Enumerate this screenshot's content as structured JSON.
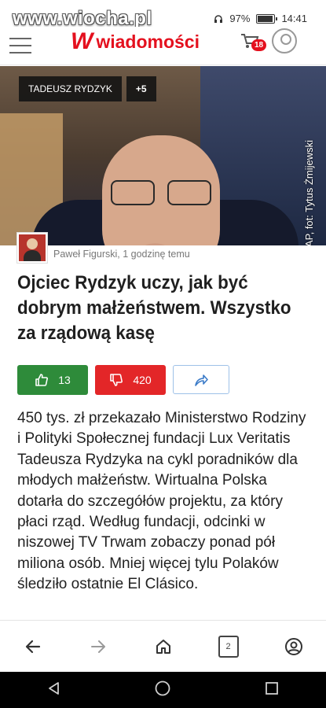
{
  "status": {
    "watermark": "www.wiocha.pl",
    "battery": "97%",
    "time": "14:41"
  },
  "header": {
    "logo_mark": "W",
    "logo_text": "wiadomości",
    "cart_count": "18"
  },
  "hero": {
    "tags": [
      "TADEUSZ RYDZYK",
      "+5"
    ],
    "credit": "Źródło: PAP, fot: Tytus Żmijewski"
  },
  "article": {
    "author_meta": "Paweł Figurski, 1 godzinę temu",
    "title": "Ojciec Rydzyk uczy, jak być dobrym małżeństwem. Wszystko za rządową kasę",
    "likes": "13",
    "dislikes": "420",
    "lead": "450 tys. zł przekazało Ministerstwo Rodziny i Polityki Społecznej fundacji Lux Veritatis Tadeusza Rydzyka na cykl poradników dla młodych małżeństw. Wirtualna Polska dotarła do szczegółów projektu, za który płaci rząd. Według fundacji, odcinki w niszowej TV Trwam zobaczy ponad pół miliona osób. Mniej więcej tylu Polaków śledziło ostatnie El Clásico."
  },
  "toolbar": {
    "tab_count": "2"
  },
  "colors": {
    "brand": "#e4101e",
    "like": "#2e8b3a",
    "dislike": "#e32628"
  }
}
